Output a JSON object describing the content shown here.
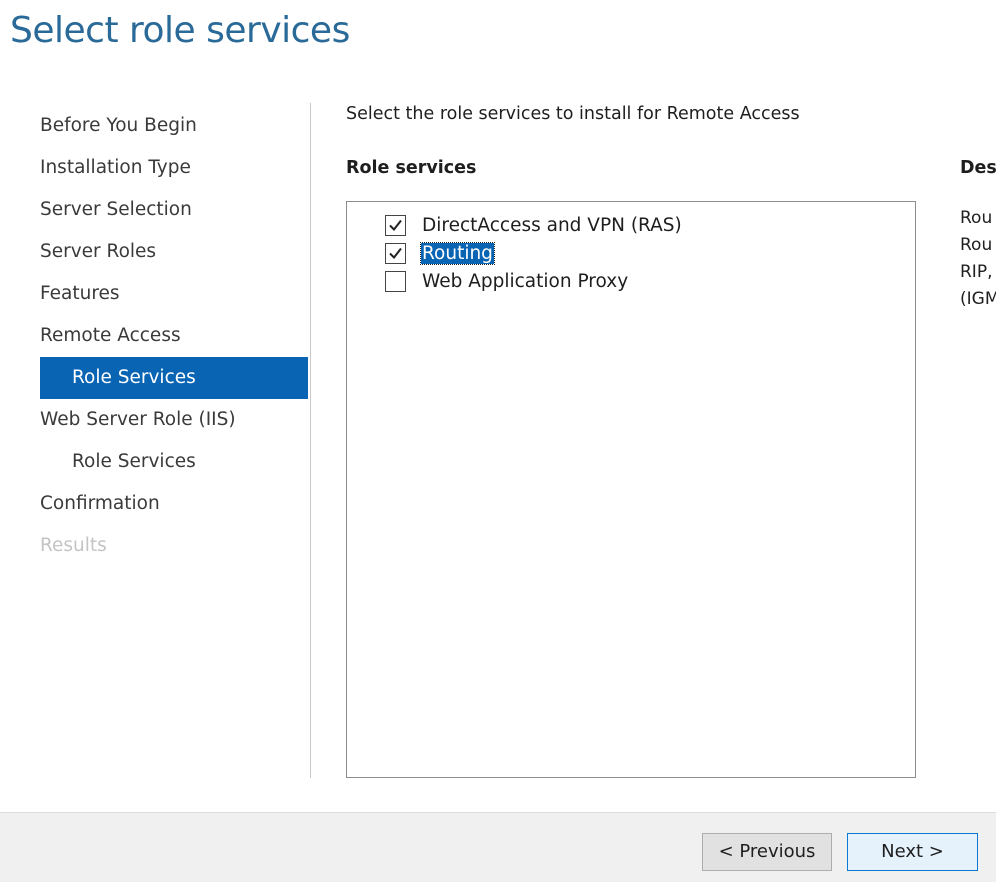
{
  "page_title": "Select role services",
  "nav": {
    "items": [
      {
        "label": "Before You Begin"
      },
      {
        "label": "Installation Type"
      },
      {
        "label": "Server Selection"
      },
      {
        "label": "Server Roles"
      },
      {
        "label": "Features"
      },
      {
        "label": "Remote Access"
      },
      {
        "label": "Role Services",
        "active": true
      },
      {
        "label": "Web Server Role (IIS)"
      },
      {
        "label": "Role Services"
      },
      {
        "label": "Confirmation"
      },
      {
        "label": "Results",
        "disabled": true
      }
    ]
  },
  "main": {
    "instruction": "Select the role services to install for Remote Access",
    "role_services_heading": "Role services",
    "description_heading": "Des",
    "services": [
      {
        "label": "DirectAccess and VPN (RAS)",
        "checked": true
      },
      {
        "label": "Routing",
        "checked": true,
        "selected": true
      },
      {
        "label": "Web Application Proxy",
        "checked": false
      }
    ],
    "description_lines": [
      "Rou",
      "Rou",
      "RIP,",
      "(IGM"
    ]
  },
  "footer": {
    "previous_label": "< Previous",
    "next_label": "Next >"
  },
  "colors": {
    "title": "#2a6a99",
    "accent": "#0a64b4",
    "disabled_text": "#c4c4c4",
    "footer_bg": "#f0f0f0"
  }
}
